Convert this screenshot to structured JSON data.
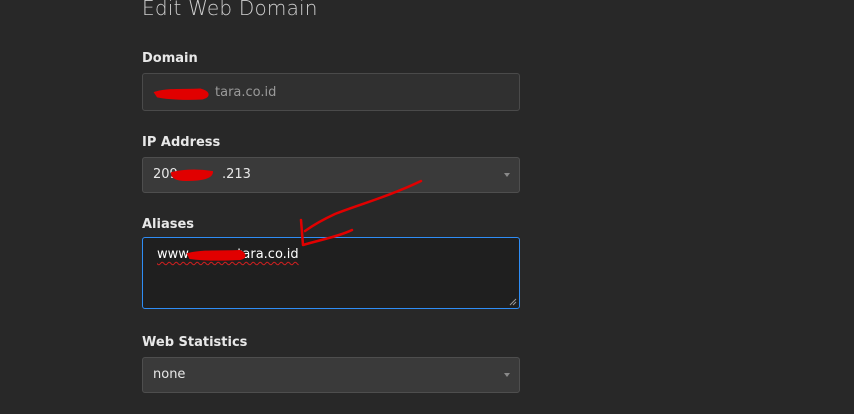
{
  "form": {
    "title": "Edit Web Domain",
    "domain": {
      "label": "Domain",
      "value": "tara.co.id"
    },
    "ip_address": {
      "label": "IP Address",
      "value_prefix": "209.",
      "value_suffix": ".213"
    },
    "aliases": {
      "label": "Aliases",
      "value": "www.           tara.co.id"
    },
    "web_statistics": {
      "label": "Web Statistics",
      "value": "none"
    }
  },
  "colors": {
    "background": "#282828",
    "focus_border": "#2f8df5",
    "annotation": "#e10000"
  },
  "icons": {
    "select_caret": "chevron-down-icon",
    "textarea_resize": "resize-grip-icon"
  }
}
